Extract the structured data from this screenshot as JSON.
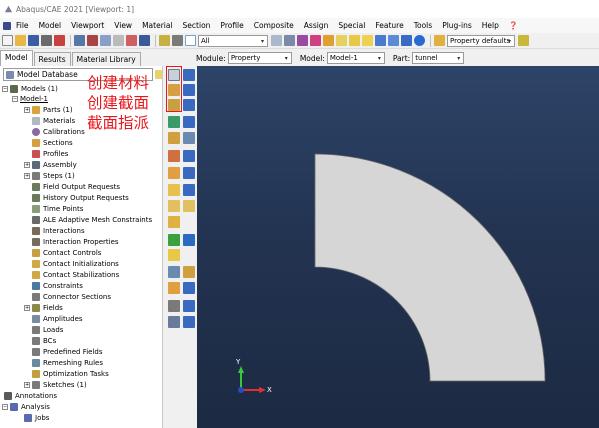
{
  "window": {
    "title": "Abaqus/CAE 2021 [Viewport: 1]"
  },
  "menu": [
    "File",
    "Model",
    "Viewport",
    "View",
    "Material",
    "Section",
    "Profile",
    "Composite",
    "Assign",
    "Special",
    "Feature",
    "Tools",
    "Plug-ins",
    "Help",
    "❓"
  ],
  "toolbar": {
    "render_style": "All",
    "view_defaults": "Property defaults"
  },
  "tabs": [
    "Model",
    "Results",
    "Material Library"
  ],
  "context": {
    "module_label": "Module:",
    "module": "Property",
    "model_label": "Model:",
    "model": "Model-1",
    "part_label": "Part:",
    "part": "tunnel"
  },
  "tree": {
    "header": "Model Database",
    "items": [
      {
        "label": "Models (1)"
      },
      {
        "label": "Model-1"
      },
      {
        "label": "Parts (1)"
      },
      {
        "label": "Materials"
      },
      {
        "label": "Calibrations"
      },
      {
        "label": "Sections"
      },
      {
        "label": "Profiles"
      },
      {
        "label": "Assembly"
      },
      {
        "label": "Steps (1)"
      },
      {
        "label": "Field Output Requests"
      },
      {
        "label": "History Output Requests"
      },
      {
        "label": "Time Points"
      },
      {
        "label": "ALE Adaptive Mesh Constraints"
      },
      {
        "label": "Interactions"
      },
      {
        "label": "Interaction Properties"
      },
      {
        "label": "Contact Controls"
      },
      {
        "label": "Contact Initializations"
      },
      {
        "label": "Contact Stabilizations"
      },
      {
        "label": "Constraints"
      },
      {
        "label": "Connector Sections"
      },
      {
        "label": "Fields"
      },
      {
        "label": "Amplitudes"
      },
      {
        "label": "Loads"
      },
      {
        "label": "BCs"
      },
      {
        "label": "Predefined Fields"
      },
      {
        "label": "Remeshing Rules"
      },
      {
        "label": "Optimization Tasks"
      },
      {
        "label": "Sketches (1)"
      },
      {
        "label": "Annotations"
      },
      {
        "label": "Analysis"
      },
      {
        "label": "Jobs"
      }
    ]
  },
  "annotations": [
    "创建材料",
    "创建截面",
    "截面指派"
  ],
  "triad": {
    "y_label": "Y",
    "x_label": "X"
  },
  "colors": {
    "viewport_top": "#2d4468",
    "part_fill": "#d6d6d6",
    "annotation": "#e8171c",
    "highlight_box": "#e8171c"
  }
}
